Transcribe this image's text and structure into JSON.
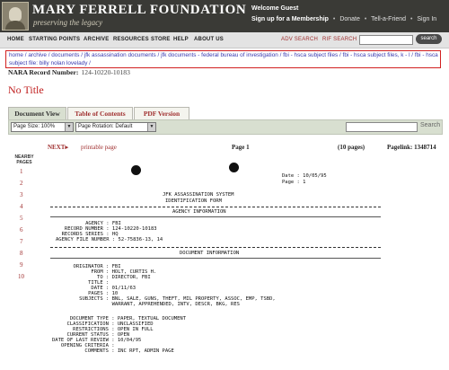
{
  "header": {
    "title": "MARY FERRELL FOUNDATION",
    "tagline": "preserving the legacy",
    "welcome": "Welcome Guest",
    "signup": "Sign up for a Membership",
    "donate": "Donate",
    "tell": "Tell-a-Friend",
    "signin": "Sign In"
  },
  "nav": {
    "items": [
      "HOME",
      "STARTING POINTS",
      "ARCHIVE",
      "RESOURCES",
      "STORE",
      "HELP",
      "ABOUT US"
    ],
    "adv_search": "ADV SEARCH",
    "rif_search": "RIF SEARCH",
    "search_button": "search"
  },
  "breadcrumb": "home / archive / documents / jfk assassination documents / jfk documents - federal bureau of investigation / fbi - hsca subject files / fbi - hsca subject files, k - l / fbi - hsca subject file: billy nolan lovelady /",
  "record": {
    "label": "NARA Record Number:",
    "number": "124-10220-10183"
  },
  "doc_title": "No Title",
  "tabs": [
    "Document View",
    "Table of Contents",
    "PDF Version"
  ],
  "toolbar": {
    "page_size": "Page Size: 100%",
    "page_rotation": "Page Rotation: Default",
    "search_label": "Search"
  },
  "pager": {
    "next": "NEXT",
    "printable": "printable page",
    "page": "Page 1",
    "count": "(10 pages)",
    "pagelink": "Pagelink: 1348714"
  },
  "nearby": {
    "label": "NEARBY PAGES",
    "pages": [
      "1",
      "2",
      "3",
      "4",
      "5",
      "6",
      "7",
      "8",
      "9",
      "10"
    ]
  },
  "document": {
    "date_line": "Date : 10/05/95",
    "page_line": "Page : 1",
    "system_title": "JFK ASSASSINATION SYSTEM",
    "form_title": "IDENTIFICATION FORM",
    "agency_section": "AGENCY INFORMATION",
    "agency_fields": [
      "          AGENCY : FBI",
      "   RECORD NUMBER : 124-10220-10183",
      "  RECORDS SERIES : HQ",
      "AGENCY FILE NUMBER : 52-75836-13, 14"
    ],
    "document_section": "DOCUMENT INFORMATION",
    "doc_fields": [
      "     ORIGINATOR : FBI",
      "           FROM : HOLT, CURTIS H.",
      "             TO : DIRECTOR, FBI",
      "          TITLE :",
      "           DATE : 01/11/63",
      "          PAGES : 10",
      "       SUBJECTS : BNL, SALE, GUNS, THEFT, MIL PROPERTY, ASSOC, EMP, TSBD,",
      "                  WARRANT, APPREHENDED, INTV, DESCR, BKG, RES"
    ],
    "doc_fields2": [
      "      DOCUMENT TYPE : PAPER, TEXTUAL DOCUMENT",
      "     CLASSIFICATION : UNCLASSIFIED",
      "       RESTRICTIONS : OPEN IN FULL",
      "     CURRENT STATUS : OPEN",
      "DATE OF LAST REVIEW : 10/04/95",
      "   OPENING CRITERIA :",
      "           COMMENTS : INC RPT, ADMIN PAGE"
    ]
  }
}
